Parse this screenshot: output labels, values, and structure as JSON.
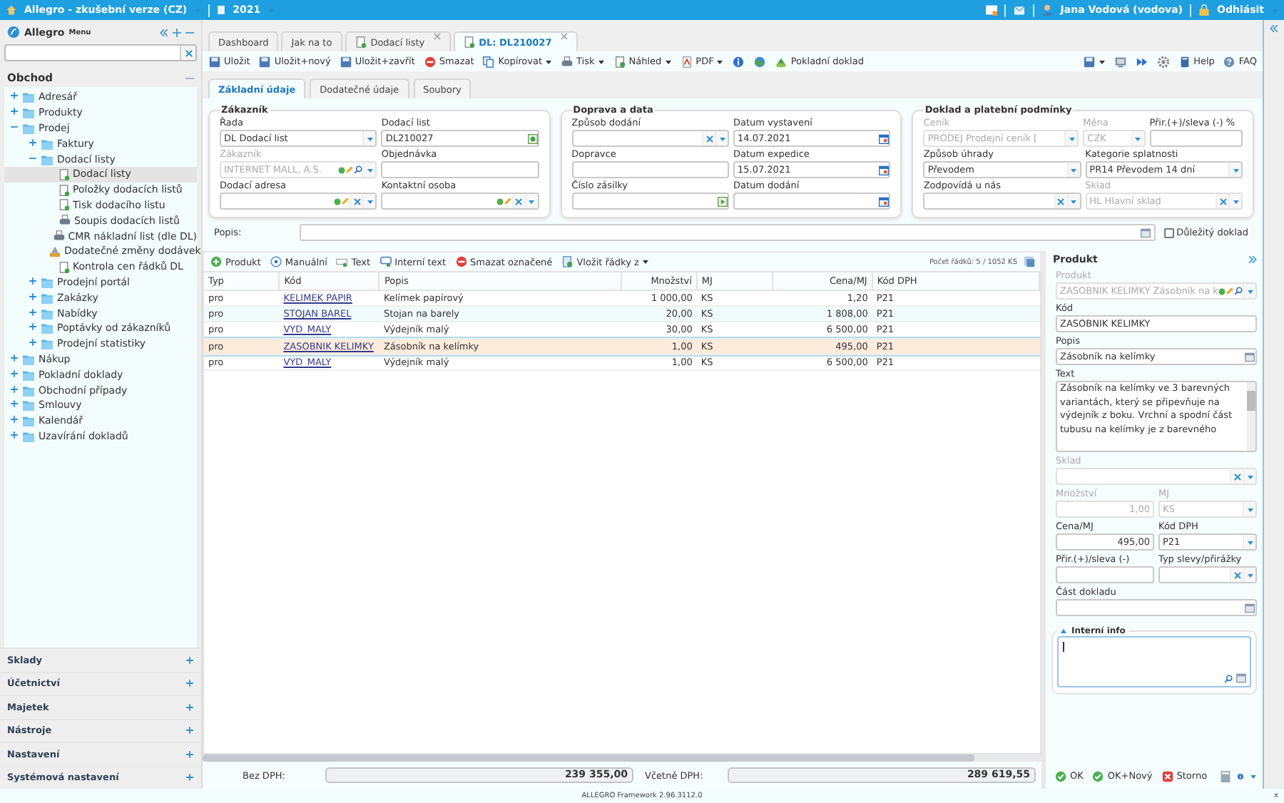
{
  "top_bar": {
    "app_title": "Allegro - zkušební verze (CZ)",
    "year": "2021",
    "user": "Jana Vodová (vodova)",
    "logout": "Odhlásit"
  },
  "sidebar": {
    "brand": "Allegro",
    "menu_label": "Menu",
    "section": {
      "title": "Obchod",
      "expanded": true,
      "items": [
        {
          "label": "Adresář",
          "kind": "folder",
          "expanded": false,
          "selected": false
        },
        {
          "label": "Produkty",
          "kind": "folder",
          "expanded": false,
          "selected": false
        },
        {
          "label": "Prodej",
          "kind": "folder",
          "expanded": true,
          "selected": false,
          "children": [
            {
              "label": "Faktury",
              "kind": "folder",
              "expanded": false,
              "selected": false
            },
            {
              "label": "Dodací listy",
              "kind": "folder",
              "expanded": true,
              "selected": false,
              "children": [
                {
                  "label": "Dodací listy",
                  "kind": "document",
                  "selected": true
                },
                {
                  "label": "Položky dodacích listů",
                  "kind": "document",
                  "selected": false
                },
                {
                  "label": "Tisk dodacího listu",
                  "kind": "document",
                  "selected": false
                },
                {
                  "label": "Soupis dodacích listů",
                  "kind": "printer",
                  "selected": false
                },
                {
                  "label": "CMR nákladní list (dle DL)",
                  "kind": "printer",
                  "selected": false
                },
                {
                  "label": "Dodatečné změny dodávek",
                  "kind": "tool",
                  "selected": false
                },
                {
                  "label": "Kontrola cen řádků DL",
                  "kind": "document",
                  "selected": false
                }
              ]
            },
            {
              "label": "Prodejní portál",
              "kind": "folder",
              "expanded": false,
              "selected": false
            },
            {
              "label": "Zakázky",
              "kind": "folder",
              "expanded": false,
              "selected": false
            },
            {
              "label": "Nabídky",
              "kind": "folder",
              "expanded": false,
              "selected": false
            },
            {
              "label": "Poptávky od zákazníků",
              "kind": "folder",
              "expanded": false,
              "selected": false
            },
            {
              "label": "Prodejní statistiky",
              "kind": "folder",
              "expanded": false,
              "selected": false
            }
          ]
        },
        {
          "label": "Nákup",
          "kind": "folder",
          "expanded": false,
          "selected": false
        },
        {
          "label": "Pokladní doklady",
          "kind": "folder",
          "expanded": false,
          "selected": false
        },
        {
          "label": "Obchodní případy",
          "kind": "folder",
          "expanded": false,
          "selected": false
        },
        {
          "label": "Smlouvy",
          "kind": "folder",
          "expanded": false,
          "selected": false
        },
        {
          "label": "Kalendář",
          "kind": "folder",
          "expanded": false,
          "selected": false
        },
        {
          "label": "Uzavírání dokladů",
          "kind": "folder",
          "expanded": false,
          "selected": false
        }
      ]
    },
    "bottom_sections": [
      {
        "title": "Sklady",
        "expanded": false
      },
      {
        "title": "Účetnictví",
        "expanded": false
      },
      {
        "title": "Majetek",
        "expanded": false
      },
      {
        "title": "Nástroje",
        "expanded": false
      },
      {
        "title": "Nastavení",
        "expanded": false
      },
      {
        "title": "Systémová nastavení",
        "expanded": false
      }
    ]
  },
  "tabs": [
    {
      "label": "Dashboard",
      "selected": false,
      "closable": false,
      "doc": false
    },
    {
      "label": "Jak na to",
      "selected": false,
      "closable": false,
      "doc": false
    },
    {
      "label": "Dodací listy",
      "selected": false,
      "closable": true,
      "doc": true
    },
    {
      "label": "DL: DL210027",
      "selected": true,
      "closable": true,
      "doc": true
    }
  ],
  "toolbar": {
    "left": [
      {
        "kind": "button",
        "label": "Uložit"
      },
      {
        "kind": "button",
        "label": "Uložit+nový"
      },
      {
        "kind": "button",
        "label": "Uložit+zavřít"
      },
      {
        "kind": "button",
        "label": "Smazat"
      },
      {
        "kind": "menu",
        "label": "Kopírovat"
      },
      {
        "kind": "menu",
        "label": "Tisk"
      },
      {
        "kind": "menu",
        "label": "Náhled"
      },
      {
        "kind": "menu",
        "label": "PDF"
      },
      {
        "kind": "icon"
      },
      {
        "kind": "icon"
      },
      {
        "kind": "button",
        "label": "Pokladní doklad"
      }
    ],
    "right": [
      {
        "kind": "menu"
      },
      {
        "kind": "icon"
      },
      {
        "kind": "icon"
      },
      {
        "kind": "icon"
      },
      {
        "kind": "button",
        "label": "Help"
      },
      {
        "kind": "button",
        "label": "FAQ"
      }
    ]
  },
  "subtabs": [
    {
      "label": "Základní údaje",
      "selected": true
    },
    {
      "label": "Dodatečné údaje",
      "selected": false
    },
    {
      "label": "Soubory",
      "selected": false
    }
  ],
  "groups": [
    {
      "title": "Zákazník",
      "rows": [
        [
          {
            "label": "Řada",
            "kind": "select",
            "value": "DL Dodací list",
            "disabled": false
          },
          {
            "label": "Dodací list",
            "kind": "code",
            "value": "DL210027",
            "disabled": false
          }
        ],
        [
          {
            "label": "Zákazník",
            "kind": "lookup",
            "value": "INTERNET MALL, A.S.",
            "disabled": true
          },
          {
            "label": "Objednávka",
            "kind": "text",
            "disabled": false
          }
        ],
        [
          {
            "label": "Dodací adresa",
            "kind": "edit-select",
            "disabled": false
          },
          {
            "label": "Kontaktní osoba",
            "kind": "edit-select",
            "disabled": false
          }
        ]
      ]
    },
    {
      "title": "Doprava a data",
      "rows": [
        [
          {
            "label": "Způsob dodání",
            "kind": "clear-select",
            "disabled": false
          },
          {
            "label": "Datum vystavení",
            "kind": "date",
            "value": "14.07.2021",
            "disabled": false
          }
        ],
        [
          {
            "label": "Dopravce",
            "kind": "text",
            "disabled": false
          },
          {
            "label": "Datum expedice",
            "kind": "date",
            "value": "15.07.2021",
            "disabled": false
          }
        ],
        [
          {
            "label": "Číslo zásilky",
            "kind": "track",
            "disabled": false
          },
          {
            "label": "Datum dodání",
            "kind": "date",
            "disabled": false
          }
        ]
      ]
    },
    {
      "title": "Doklad a platební podmínky",
      "rows": [
        [
          {
            "label": "Ceník",
            "kind": "select",
            "value": "PRODEJ Prodejní ceník [",
            "disabled": true
          },
          {
            "label": "Měna",
            "kind": "select",
            "value": "CZK",
            "disabled": true
          },
          {
            "label": "Přir.(+)/sleva (-) %",
            "kind": "text",
            "disabled": false
          }
        ],
        [
          {
            "label": "Způsob úhrady",
            "kind": "select",
            "value": "Převodem",
            "disabled": false
          },
          {
            "label": "Kategorie splatnosti",
            "kind": "select",
            "value": "PR14 Převodem 14 dní",
            "disabled": false
          }
        ],
        [
          {
            "label": "Zodpovídá u nás",
            "kind": "clear-select",
            "disabled": false
          },
          {
            "label": "Sklad",
            "kind": "clear-select",
            "value": "HL Hlavní sklad",
            "disabled": true
          }
        ]
      ]
    }
  ],
  "description": {
    "label": "Popis:",
    "important": {
      "label": "Důležitý doklad",
      "checked": false
    }
  },
  "grid_toolbar": {
    "buttons": [
      {
        "label": "Produkt",
        "menu": false
      },
      {
        "label": "Manuální",
        "menu": false
      },
      {
        "label": "Text",
        "menu": false
      },
      {
        "label": "Interní text",
        "menu": false
      },
      {
        "label": "Smazat označené",
        "menu": false
      },
      {
        "label": "Vložit řádky z",
        "menu": true
      }
    ],
    "count": "Počet řádků: 5  /  1052 KS"
  },
  "table": {
    "columns": [
      "Typ",
      "Kód",
      "Popis",
      "Množství",
      "MJ",
      "Cena/MJ",
      "Kód DPH"
    ],
    "rows": [
      {
        "selected": false,
        "cells": [
          "pro",
          "KELIMEK PAPIR",
          "Kelímek papírový",
          "1 000,00",
          "KS",
          "1,20",
          "P21"
        ]
      },
      {
        "selected": false,
        "cells": [
          "pro",
          "STOJAN BAREL",
          "Stojan na barely",
          "20,00",
          "KS",
          "1 808,00",
          "P21"
        ]
      },
      {
        "selected": false,
        "cells": [
          "pro",
          "VYD_MALY",
          "Výdejník malý",
          "30,00",
          "KS",
          "6 500,00",
          "P21"
        ]
      },
      {
        "selected": true,
        "cells": [
          "pro",
          "ZASOBNIK KELIMKY",
          "Zásobník na kelímky",
          "1,00",
          "KS",
          "495,00",
          "P21"
        ]
      },
      {
        "selected": false,
        "cells": [
          "pro",
          "VYD_MALY",
          "Výdejník malý",
          "1,00",
          "KS",
          "6 500,00",
          "P21"
        ]
      }
    ]
  },
  "totals": [
    {
      "label": "Bez DPH:",
      "value": "239 355,00"
    },
    {
      "label": "Včetně DPH:",
      "value": "289 619,55"
    }
  ],
  "product_panel": {
    "title": "Produkt",
    "rows": [
      [
        {
          "label": "Produkt",
          "kind": "lookup",
          "value": "ZASOBNIK KELIMKY Zásobník na k",
          "disabled": true
        }
      ],
      [
        {
          "label": "Kód",
          "kind": "text",
          "value": "ZASOBNIK KELIMKY",
          "disabled": false
        }
      ],
      [
        {
          "label": "Popis",
          "kind": "memo",
          "value": "Zásobník na kelímky",
          "disabled": false
        }
      ],
      [
        {
          "label": "Text",
          "kind": "textarea",
          "value": "Zásobník na kelímky ve 3 barevných variantách, který se připevňuje na výdejník z boku. Vrchní a spodní část tubusu na kelímky je z barevného",
          "disabled": false
        }
      ],
      [
        {
          "label": "Sklad",
          "kind": "clear-select",
          "disabled": true
        }
      ],
      [
        {
          "label": "Množství",
          "kind": "number",
          "value": "1,00",
          "disabled": true
        },
        {
          "label": "MJ",
          "kind": "select",
          "value": "KS",
          "disabled": true
        }
      ],
      [
        {
          "label": "Cena/MJ",
          "kind": "number",
          "value": "495,00",
          "disabled": false
        },
        {
          "label": "Kód DPH",
          "kind": "select",
          "value": "P21",
          "disabled": false
        }
      ],
      [
        {
          "label": "Přir.(+)/sleva (-)",
          "kind": "text",
          "disabled": false
        },
        {
          "label": "Typ slevy/přirážky",
          "kind": "clear-select",
          "disabled": false
        }
      ],
      [
        {
          "label": "Část dokladu",
          "kind": "memo",
          "disabled": false
        }
      ]
    ],
    "internal_info": {
      "title": "Interní info",
      "expanded": true
    },
    "buttons": [
      "OK",
      "OK+Nový",
      "Storno"
    ]
  },
  "footer": {
    "version": "ALLEGRO Framework 2.96.3112.0",
    "close": "x"
  }
}
